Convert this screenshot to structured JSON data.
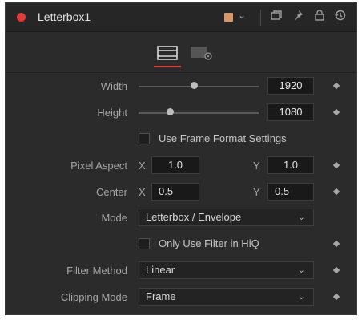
{
  "header": {
    "title": "Letterbox1"
  },
  "controls": {
    "width": {
      "label": "Width",
      "value": "1920",
      "slider_fraction": 0.46
    },
    "height": {
      "label": "Height",
      "value": "1080",
      "slider_fraction": 0.26
    },
    "use_frame_format": {
      "label": "Use Frame Format Settings",
      "checked": false
    },
    "pixel_aspect": {
      "label": "Pixel Aspect",
      "x_label": "X",
      "x": "1.0",
      "y_label": "Y",
      "y": "1.0"
    },
    "center": {
      "label": "Center",
      "x_label": "X",
      "x": "0.5",
      "y_label": "Y",
      "y": "0.5"
    },
    "mode": {
      "label": "Mode",
      "value": "Letterbox / Envelope"
    },
    "only_hiq": {
      "label": "Only Use Filter in HiQ",
      "checked": false
    },
    "filter_method": {
      "label": "Filter Method",
      "value": "Linear"
    },
    "clipping_mode": {
      "label": "Clipping Mode",
      "value": "Frame"
    }
  },
  "icons": [
    "record-dot-icon",
    "color-swatch-icon",
    "chevron-down-icon",
    "version-icon",
    "pin-icon",
    "lock-icon",
    "reset-icon",
    "controls-tab-icon",
    "settings-tab-icon",
    "keyframe-diamond-icon"
  ],
  "colors": {
    "accent": "#e23a36",
    "swatch": "#d8996a",
    "panel": "#2b2b2b"
  }
}
